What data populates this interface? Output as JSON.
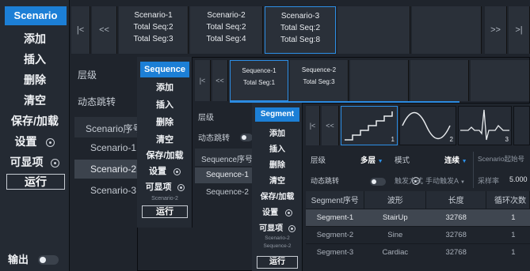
{
  "scenario": {
    "sidebar": {
      "title": "Scenario",
      "items": [
        "添加",
        "插入",
        "删除",
        "清空",
        "保存/加载",
        "设置",
        "可显项"
      ],
      "run": "运行",
      "output": "输出"
    },
    "nav": {
      "first": "|<",
      "prev": "<<",
      "next": ">>",
      "last": ">|"
    },
    "cards": [
      {
        "name": "Scenario-1",
        "seq": "Total Seq:2",
        "seg": "Total Seg:3"
      },
      {
        "name": "Scenario-2",
        "seq": "Total Seq:2",
        "seg": "Total Seg:4"
      },
      {
        "name": "Scenario-3",
        "seq": "Total Seq:2",
        "seg": "Total Seg:8"
      }
    ],
    "level_label": "层级",
    "jump_label": "动态跳转",
    "list_header": "Scenario序号",
    "list": [
      "Scenario-1",
      "Scenario-2",
      "Scenario-3"
    ]
  },
  "sequence": {
    "sidebar": {
      "title": "Sequence",
      "items": [
        "添加",
        "插入",
        "删除",
        "清空",
        "保存/加载",
        "设置",
        "可显项"
      ],
      "context": "Scenario-2",
      "run": "运行"
    },
    "nav": {
      "first": "|<",
      "prev": "<<"
    },
    "cards": [
      {
        "name": "Sequence-1",
        "seg": "Total Seg:1"
      },
      {
        "name": "Sequence-2",
        "seg": "Total Seg:3"
      }
    ],
    "level_label": "层级",
    "jump_label": "动态跳转",
    "list_header": "Sequence序号",
    "list": [
      "Sequence-1",
      "Sequence-2"
    ]
  },
  "segment": {
    "sidebar": {
      "title": "Segment",
      "items": [
        "添加",
        "插入",
        "删除",
        "清空",
        "保存/加载",
        "设置",
        "可显项"
      ],
      "context1": "Scenario-2",
      "context2": "Sequence-2",
      "run": "运行"
    },
    "nav": {
      "first": "|<",
      "prev": "<<"
    },
    "thumbs": [
      {
        "index": "1",
        "shape": "stair"
      },
      {
        "index": "2",
        "shape": "sine"
      },
      {
        "index": "3",
        "shape": "cardiac"
      }
    ],
    "controls": {
      "level_label": "层级",
      "level_value": "多层",
      "mode_label": "模式",
      "mode_value": "连续",
      "start_label": "Scenario起始号",
      "jump_label": "动态跳转",
      "trigger_label": "触发方式",
      "trigger_value": "手动触发A",
      "rate_label": "采样率",
      "rate_value": "5.000"
    },
    "table": {
      "headers": [
        "Segment序号",
        "波形",
        "长度",
        "循环次数"
      ],
      "rows": [
        [
          "Segment-1",
          "StairUp",
          "32768",
          "1"
        ],
        [
          "Segment-2",
          "Sine",
          "32768",
          "1"
        ],
        [
          "Segment-3",
          "Cardiac",
          "32768",
          "1"
        ]
      ]
    }
  },
  "colors": {
    "accent": "#2b8ae0",
    "sidebar": "#242a33",
    "panel": "#1f242c"
  }
}
